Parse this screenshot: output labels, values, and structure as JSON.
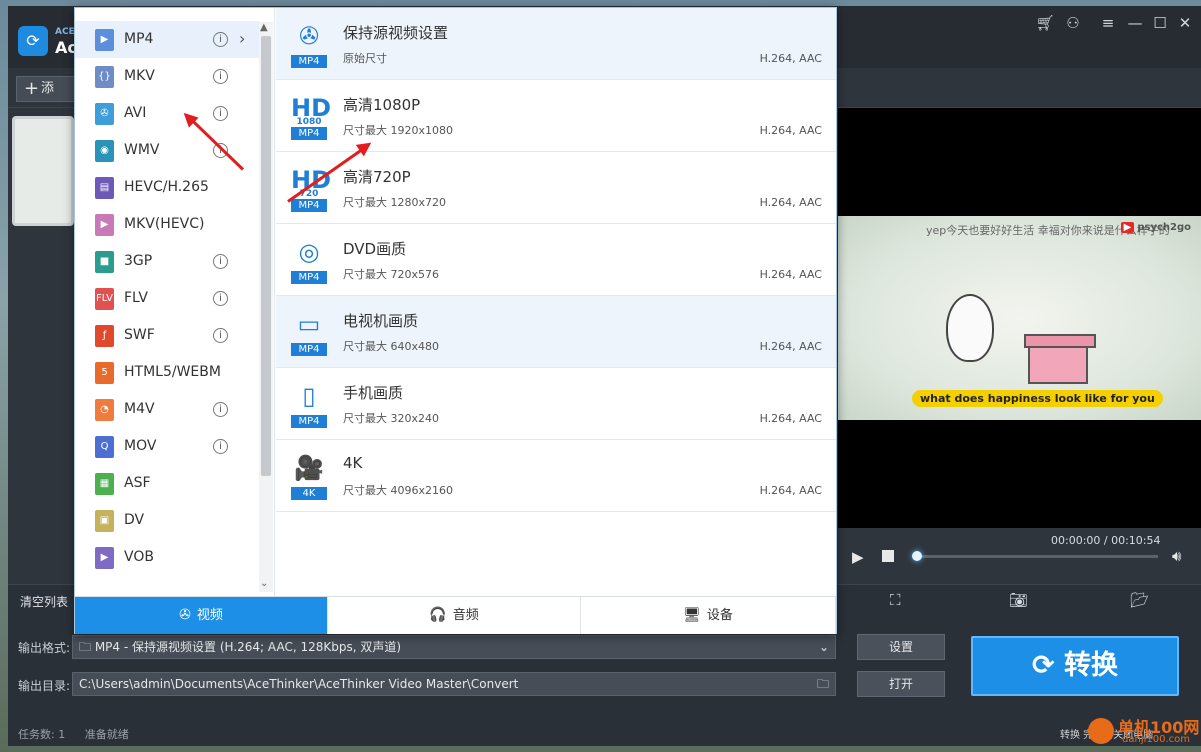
{
  "app": {
    "name_small": "ACE",
    "name": "Ace",
    "add_label": "添",
    "window_controls": [
      "cart-icon",
      "user-icon",
      "menu-icon",
      "minimize-icon",
      "maximize-icon",
      "close-icon"
    ]
  },
  "format_list": [
    {
      "label": "MP4",
      "info": true,
      "active": true,
      "color": "#5b8fd9",
      "glyph": "▶"
    },
    {
      "label": "MKV",
      "info": true,
      "color": "#6e8cc7",
      "glyph": "{}"
    },
    {
      "label": "AVI",
      "info": true,
      "color": "#3f9dd8",
      "glyph": "✇"
    },
    {
      "label": "WMV",
      "info": true,
      "color": "#2b93b8",
      "glyph": "◉"
    },
    {
      "label": "HEVC/H.265",
      "info": false,
      "color": "#6c59b8",
      "glyph": "▤"
    },
    {
      "label": "MKV(HEVC)",
      "info": false,
      "color": "#c978b8",
      "glyph": "▶"
    },
    {
      "label": "3GP",
      "info": true,
      "color": "#2a9d8f",
      "glyph": "■"
    },
    {
      "label": "FLV",
      "info": true,
      "color": "#e05151",
      "glyph": "FLV"
    },
    {
      "label": "SWF",
      "info": true,
      "color": "#e0492b",
      "glyph": "ƒ"
    },
    {
      "label": "HTML5/WEBM",
      "info": false,
      "color": "#e86b2b",
      "glyph": "5"
    },
    {
      "label": "M4V",
      "info": true,
      "color": "#f07b3f",
      "glyph": "◔"
    },
    {
      "label": "MOV",
      "info": true,
      "color": "#4d6fd1",
      "glyph": "Q"
    },
    {
      "label": "ASF",
      "info": false,
      "color": "#4caf50",
      "glyph": "▦"
    },
    {
      "label": "DV",
      "info": false,
      "color": "#c4b35a",
      "glyph": "▣"
    },
    {
      "label": "VOB",
      "info": false,
      "color": "#7e6bc4",
      "glyph": "▶"
    }
  ],
  "presets": [
    {
      "title": "保持源视频设置",
      "sub": "原始尺寸",
      "codec": "H.264, AAC",
      "glyph": "✇",
      "glyph_small": "",
      "badge": "MP4"
    },
    {
      "title": "高清1080P",
      "sub": "尺寸最大  1920x1080",
      "codec": "H.264, AAC",
      "glyph": "HD",
      "glyph_small": "1080",
      "badge": "MP4"
    },
    {
      "title": "高清720P",
      "sub": "尺寸最大  1280x720",
      "codec": "H.264, AAC",
      "glyph": "HD",
      "glyph_small": "720",
      "badge": "MP4"
    },
    {
      "title": "DVD画质",
      "sub": "尺寸最大  720x576",
      "codec": "H.264, AAC",
      "glyph": "◎",
      "glyph_small": "",
      "badge": "MP4"
    },
    {
      "title": "电视机画质",
      "sub": "尺寸最大  640x480",
      "codec": "H.264, AAC",
      "glyph": "▭",
      "glyph_small": "",
      "badge": "MP4"
    },
    {
      "title": "手机画质",
      "sub": "尺寸最大  320x240",
      "codec": "H.264, AAC",
      "glyph": "▯",
      "glyph_small": "",
      "badge": "MP4"
    },
    {
      "title": "4K",
      "sub": "尺寸最大  4096x2160",
      "codec": "H.264, AAC",
      "glyph": "🎥",
      "glyph_small": "",
      "badge": "4K"
    }
  ],
  "tabs": [
    {
      "label": "视频",
      "icon": "film-reel-icon",
      "glyph": "✇",
      "active": true
    },
    {
      "label": "音频",
      "icon": "headphones-icon",
      "glyph": "🎧",
      "active": false
    },
    {
      "label": "设备",
      "icon": "devices-icon",
      "glyph": "🖥",
      "active": false
    }
  ],
  "preview": {
    "top_text": "yep今天也要好好生活   幸福对你来说是什么样子的",
    "channel": "psych2go",
    "yt_label": "▶",
    "subtitle": "what does happiness look like for you",
    "time": "00:00:00 / 00:10:54",
    "progress": 0.0
  },
  "toolbar": {
    "clear_list": "清空列表"
  },
  "output": {
    "format_label": "输出格式:",
    "format_value": "MP4 - 保持源视频设置 (H.264; AAC, 128Kbps, 双声道)",
    "dir_label": "输出目录:",
    "dir_value": "C:\\Users\\admin\\Documents\\AceThinker\\AceThinker Video Master\\Convert",
    "settings_btn": "设置",
    "open_btn": "打开",
    "convert_btn": "转换"
  },
  "status": {
    "tasks": "任务数: 1",
    "ready": "准备就绪"
  },
  "watermark": {
    "line1": "单机100网",
    "line2": "danji100.com",
    "left": "转换 完成后关闭电脑"
  }
}
